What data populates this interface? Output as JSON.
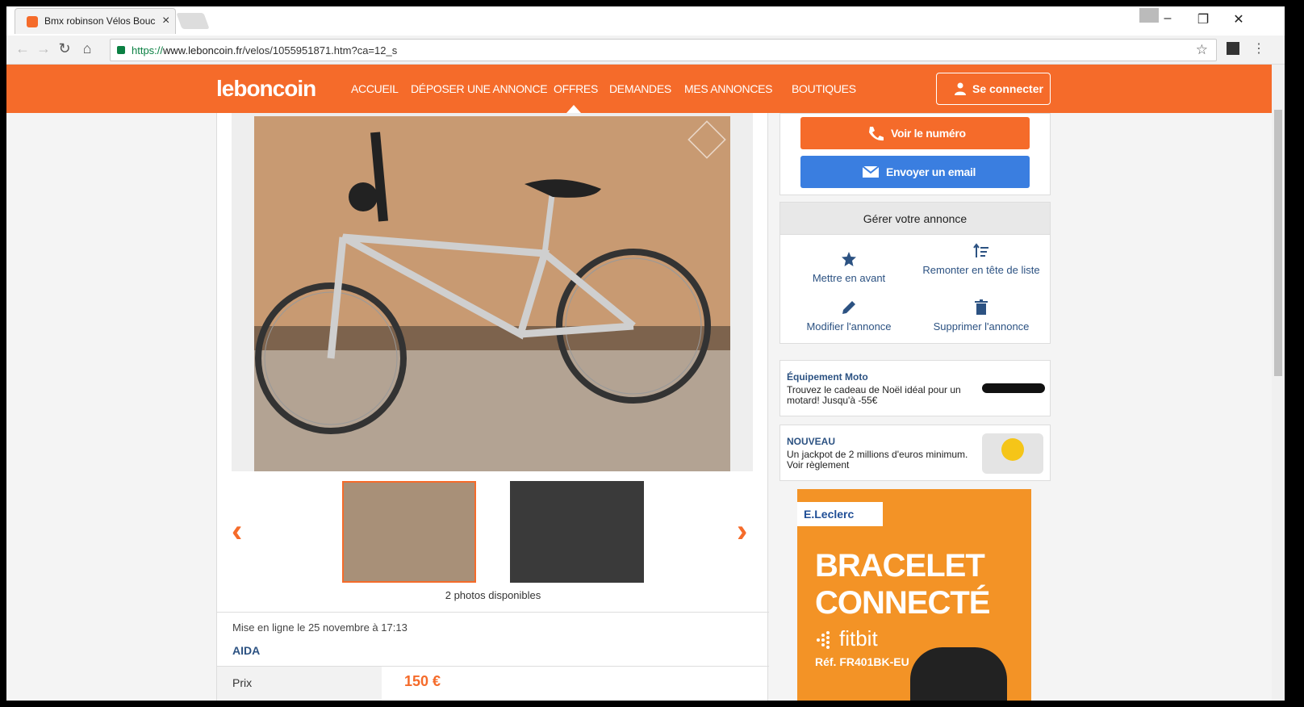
{
  "browser": {
    "tab_title": "Bmx robinson Vélos Bouc",
    "url_scheme": "https://",
    "url_host": "www.leboncoin.fr",
    "url_path": "/velos/1055951871.htm?ca=12_s"
  },
  "header": {
    "logo": "leboncoin",
    "nav": [
      "Accueil",
      "Déposer une annonce",
      "Offres",
      "Demandes",
      "Mes annonces",
      "Boutiques"
    ],
    "active_nav": "Offres",
    "login_label": "Se connecter"
  },
  "listing": {
    "photos_count": "2 photos disponibles",
    "posted": "Mise en ligne le 25 novembre à 17:13",
    "seller": "AIDA",
    "price_label": "Prix",
    "price_value": "150 €"
  },
  "contact": {
    "phone_label": "Voir le numéro",
    "email_label": "Envoyer un email"
  },
  "manage": {
    "title": "Gérer votre annonce",
    "actions": [
      "Mettre en avant",
      "Remonter en tête de liste",
      "Modifier l'annonce",
      "Supprimer l'annonce"
    ]
  },
  "ads": [
    {
      "title": "Équipement Moto",
      "text": "Trouvez le cadeau de Noël idéal pour un motard! Jusqu'à -55€"
    },
    {
      "title": "NOUVEAU",
      "text": "Un jackpot de 2 millions d'euros minimum. Voir règlement"
    }
  ],
  "banner": {
    "brand": "E.Leclerc",
    "line1": "BRACELET",
    "line2": "CONNECTÉ",
    "product": "fitbit",
    "ref": "Réf. FR401BK-EU"
  },
  "colors": {
    "brand_orange": "#f56b2a",
    "link_blue": "#2c5282",
    "email_blue": "#3a7ee0"
  }
}
